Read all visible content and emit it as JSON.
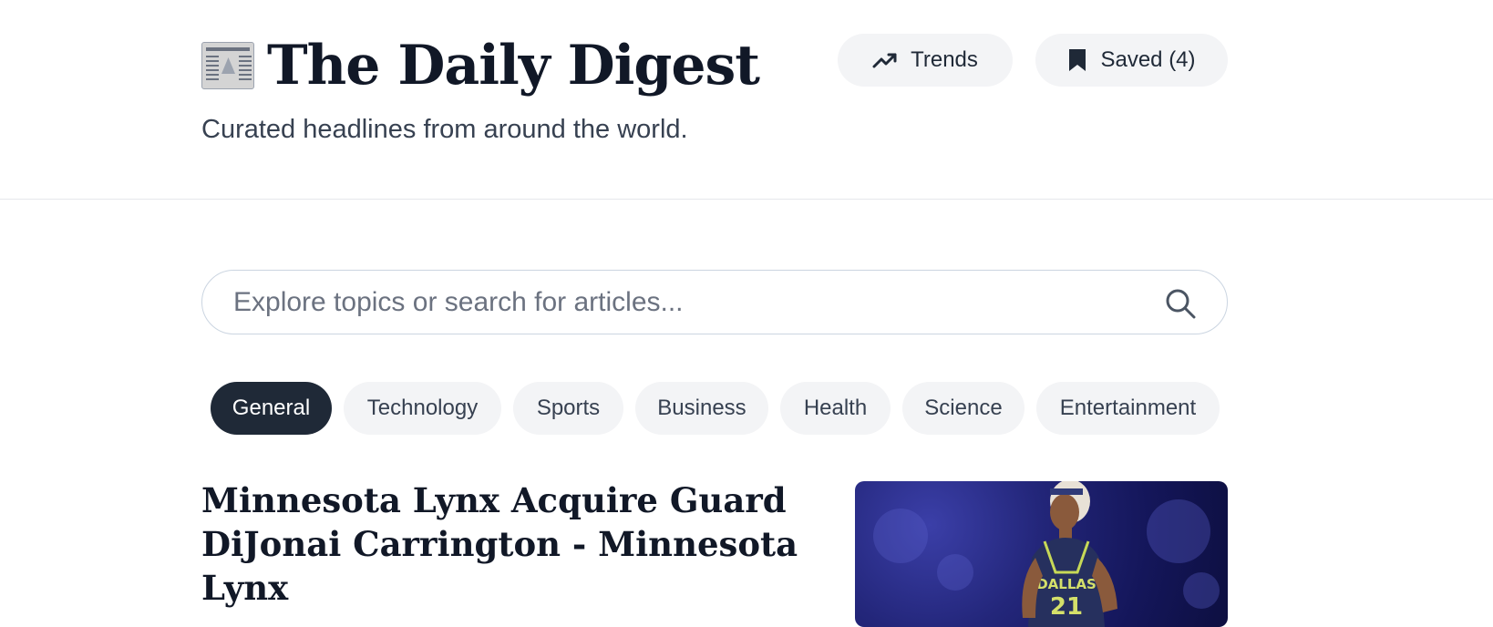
{
  "header": {
    "brand_icon": "newspaper-icon",
    "title": "The Daily Digest",
    "tagline": "Curated headlines from around the world.",
    "trends_label": "Trends",
    "trends_icon": "trending-up-icon",
    "saved_label": "Saved (4)",
    "saved_icon": "bookmark-icon"
  },
  "search": {
    "placeholder": "Explore topics or search for articles...",
    "value": "",
    "icon": "search-icon"
  },
  "categories": [
    {
      "label": "General",
      "active": true
    },
    {
      "label": "Technology",
      "active": false
    },
    {
      "label": "Sports",
      "active": false
    },
    {
      "label": "Business",
      "active": false
    },
    {
      "label": "Health",
      "active": false
    },
    {
      "label": "Science",
      "active": false
    },
    {
      "label": "Entertainment",
      "active": false
    }
  ],
  "article": {
    "title": "Minnesota Lynx Acquire Guard DiJonai Carrington - Minnesota Lynx",
    "image_jersey_text": "DALLAS",
    "image_jersey_number": "21"
  },
  "colors": {
    "chip_active_bg": "#1f2937",
    "chip_bg": "#f3f4f6",
    "text_primary": "#111827",
    "text_secondary": "#374151"
  }
}
